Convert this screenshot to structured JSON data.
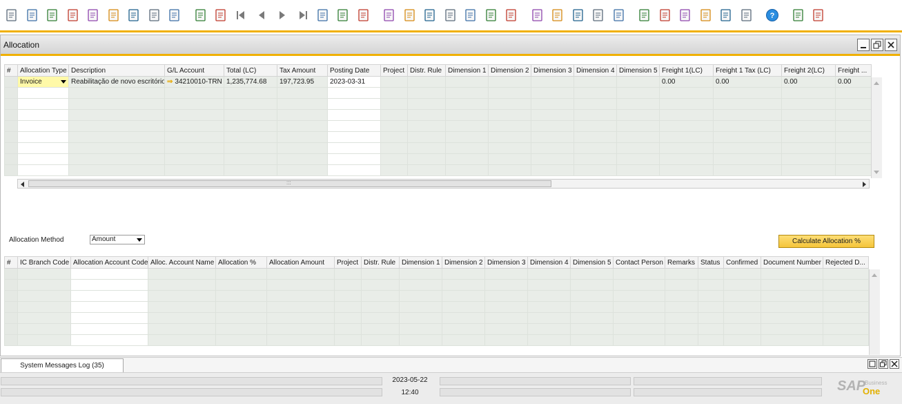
{
  "toolbar": {
    "icons": [
      "print-preview",
      "print",
      "email",
      "send-sms",
      "export-excel",
      "export-word",
      "export-pdf",
      "move-icon",
      "lock-icon",
      "find",
      "add",
      "first-record",
      "previous-record",
      "next-record",
      "last-record",
      "refresh",
      "filter",
      "sort",
      "base-document",
      "target-document",
      "layout",
      "relationship-map",
      "gross-profit",
      "journal-entry",
      "settings",
      "edit",
      "form-settings",
      "query",
      "messages",
      "alerts",
      "calendar",
      "inbox",
      "calculator",
      "org-chart",
      "user",
      "web-browser",
      "help",
      "document-one",
      "document-two"
    ]
  },
  "window": {
    "title": "Allocation"
  },
  "top_grid": {
    "headers": [
      "#",
      "Allocation Type",
      "Description",
      "G/L Account",
      "Total (LC)",
      "Tax Amount",
      "Posting Date",
      "Project",
      "Distr. Rule",
      "Dimension 1",
      "Dimension 2",
      "Dimension 3",
      "Dimension 4",
      "Dimension 5",
      "Freight 1(LC)",
      "Freight 1 Tax (LC)",
      "Freight 2(LC)",
      "Freight ..."
    ],
    "row1": {
      "num": "",
      "allocation_type": "Invoice",
      "description": "Reabilitação de novo escritório",
      "gl_account": "34210010-TRN",
      "total_lc": "1,235,774.68",
      "tax_amount": "197,723.95",
      "posting_date": "2023-03-31",
      "freight1": "0.00",
      "freight1_tax": "0.00",
      "freight2": "0.00",
      "freight3": "0.00"
    },
    "scroll_grip": ":::"
  },
  "allocation_method": {
    "label": "Allocation Method",
    "value": "Amount"
  },
  "calculate_button": "Calculate Allocation %",
  "bottom_grid": {
    "headers": [
      "#",
      "IC Branch Code",
      "Allocation Account Code",
      "Alloc. Account Name",
      "Allocation %",
      "Allocation Amount",
      "Project",
      "Distr. Rule",
      "Dimension 1",
      "Dimension 2",
      "Dimension 3",
      "Dimension 4",
      "Dimension 5",
      "Contact Person",
      "Remarks",
      "Status",
      "Confirmed",
      "Document Number",
      "Rejected D..."
    ]
  },
  "messages": {
    "tab_label": "System Messages Log (35)"
  },
  "status": {
    "date": "2023-05-22",
    "time": "12:40"
  },
  "logo": {
    "brand": "SAP",
    "business": "Business",
    "one": "One"
  }
}
